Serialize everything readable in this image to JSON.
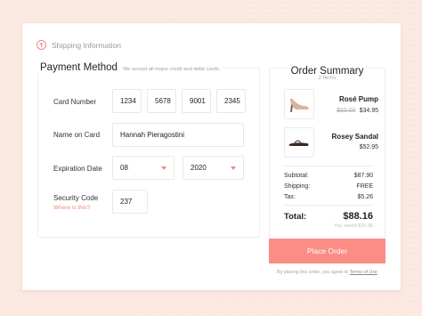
{
  "shipping": {
    "label": "Shipping Information",
    "icon": "arrow-up-circle-icon",
    "accent": "#f28a7d"
  },
  "payment": {
    "title": "Payment Method",
    "note": "We accept all major credit and debit cards.",
    "card_number": {
      "label": "Card Number",
      "groups": [
        "1234",
        "5678",
        "9001",
        "2345"
      ]
    },
    "name_on_card": {
      "label": "Name on Card",
      "value": "Hannah Pieragostini"
    },
    "expiration": {
      "label": "Expiration Date",
      "month": "08",
      "year": "2020"
    },
    "security": {
      "label": "Security Code",
      "help_link": "Where is this?",
      "value": "237"
    }
  },
  "summary": {
    "title": "Order Summary",
    "count": "2 Items",
    "products": [
      {
        "name": "Rosé Pump",
        "old_price": "$55.00",
        "price": "$34.95",
        "icon": "pump-shoe-icon"
      },
      {
        "name": "Rosey Sandal",
        "price": "$52.95",
        "icon": "sandal-icon"
      }
    ],
    "subtotal_label": "Subtotal:",
    "subtotal": "$87.90",
    "shipping_label": "Shipping:",
    "shipping": "FREE",
    "tax_label": "Tax:",
    "tax": "$5.26",
    "total_label": "Total:",
    "total": "$88.16",
    "saved": "You saved $20.05"
  },
  "cta": {
    "place_order": "Place Order",
    "terms_prefix": "By placing this order, you agree to",
    "terms_link": "Terms of Use",
    "color": "#fb8c86"
  }
}
